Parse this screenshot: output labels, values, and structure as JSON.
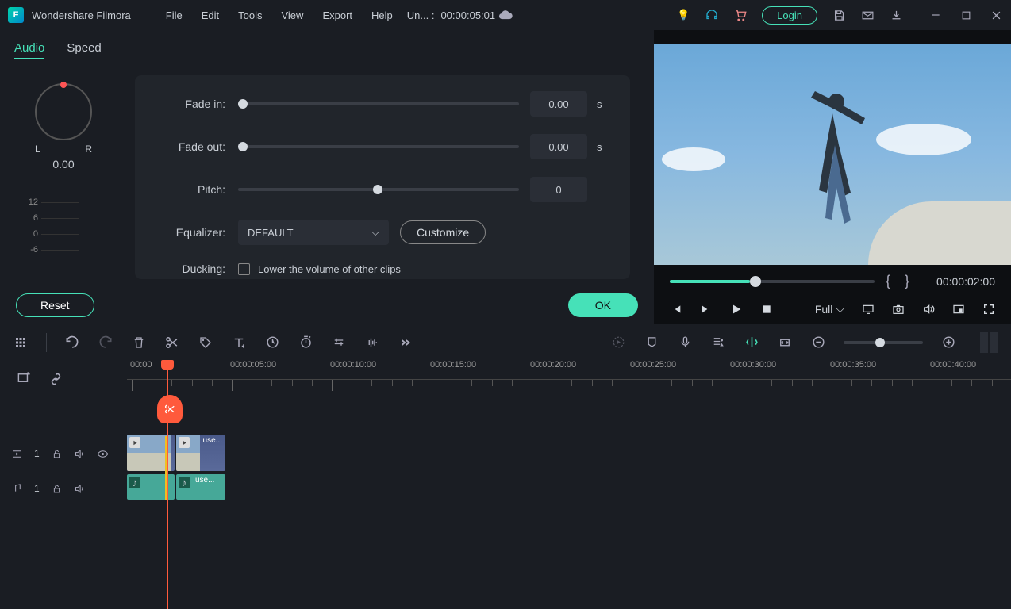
{
  "titlebar": {
    "app_name": "Wondershare Filmora",
    "menus": [
      "File",
      "Edit",
      "Tools",
      "View",
      "Export",
      "Help"
    ],
    "project_label": "Un... :",
    "project_time": "00:00:05:01",
    "login_label": "Login"
  },
  "panel": {
    "tabs": {
      "audio": "Audio",
      "speed": "Speed"
    },
    "balance": {
      "left": "L",
      "right": "R",
      "value": "0.00"
    },
    "meter_labels": [
      "12",
      "6",
      "0",
      "-6"
    ],
    "fade_in_label": "Fade in:",
    "fade_in_value": "0.00",
    "fade_out_label": "Fade out:",
    "fade_out_value": "0.00",
    "pitch_label": "Pitch:",
    "pitch_value": "0",
    "seconds_unit": "s",
    "equalizer_label": "Equalizer:",
    "equalizer_value": "DEFAULT",
    "customize_label": "Customize",
    "ducking_label": "Ducking:",
    "ducking_text": "Lower the volume of other clips",
    "reset_label": "Reset",
    "ok_label": "OK"
  },
  "preview": {
    "timecode": "00:00:02:00",
    "quality_label": "Full"
  },
  "timeline": {
    "markers": [
      "00:00",
      "00:00:05:00",
      "00:00:10:00",
      "00:00:15:00",
      "00:00:20:00",
      "00:00:25:00",
      "00:00:30:00",
      "00:00:35:00",
      "00:00:40:00"
    ],
    "video_track_num": "1",
    "audio_track_num": "1",
    "clip_label": "use..."
  }
}
